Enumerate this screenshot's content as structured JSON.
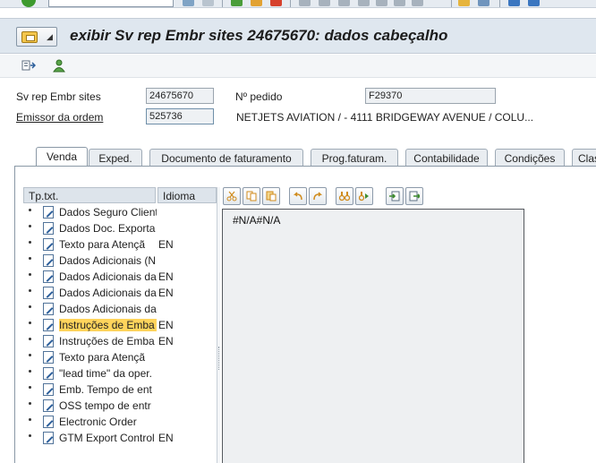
{
  "toolbar": {
    "icons": [
      "enter-icon",
      "command-field",
      "save-icon",
      "back-icon",
      "exit-icon",
      "cancel-icon",
      "print-icon",
      "find-icon",
      "find-next-icon",
      "first-page-icon",
      "prev-page-icon",
      "next-page-icon",
      "last-page-icon",
      "new-session-icon",
      "shortcut-icon",
      "help-icon",
      "settings-icon"
    ]
  },
  "title": {
    "text": "exibir Sv rep Embr sites 24675670: dados cabeçalho"
  },
  "header": {
    "doc_label": "Sv rep Embr sites",
    "doc_value": "24675670",
    "po_label": "Nº pedido",
    "po_value": "F29370",
    "issuer_label": "Emissor da ordem",
    "issuer_value": "525736",
    "issuer_name": "NETJETS AVIATION / - 4111 BRIDGEWAY AVENUE / COLU..."
  },
  "tabs": [
    {
      "label": "Venda",
      "active": true
    },
    {
      "label": "Exped.",
      "active": false
    },
    {
      "label": "Documento de faturamento",
      "active": false
    },
    {
      "label": "Prog.faturam.",
      "active": false
    },
    {
      "label": "Contabilidade",
      "active": false
    },
    {
      "label": "Condições",
      "active": false
    },
    {
      "label": "Clas",
      "active": false
    }
  ],
  "tree": {
    "col_type": "Tp.txt.",
    "col_lang": "Idioma",
    "rows": [
      {
        "text": "Dados Seguro Client",
        "lang": "",
        "selected": false
      },
      {
        "text": "Dados Doc. Exporta",
        "lang": "",
        "selected": false
      },
      {
        "text": "Texto para Atençã",
        "lang": "EN",
        "selected": false
      },
      {
        "text": "Dados Adicionais (N",
        "lang": "",
        "selected": false
      },
      {
        "text": "Dados Adicionais da",
        "lang": "EN",
        "selected": false
      },
      {
        "text": "Dados Adicionais da",
        "lang": "EN",
        "selected": false
      },
      {
        "text": "Dados Adicionais da",
        "lang": "",
        "selected": false
      },
      {
        "text": "Instruções de Emba",
        "lang": "EN",
        "selected": true
      },
      {
        "text": "Instruções de Emba",
        "lang": "EN",
        "selected": false
      },
      {
        "text": "Texto para Atençã",
        "lang": "",
        "selected": false
      },
      {
        "text": "\"lead time\" da oper.",
        "lang": "",
        "selected": false
      },
      {
        "text": "Emb. Tempo de ent",
        "lang": "",
        "selected": false
      },
      {
        "text": "OSS tempo de entr",
        "lang": "",
        "selected": false
      },
      {
        "text": "Electronic Order",
        "lang": "",
        "selected": false
      },
      {
        "text": "GTM Export Control",
        "lang": "EN",
        "selected": false
      }
    ]
  },
  "editor": {
    "content": "#N/A#N/A",
    "tools": [
      "cut-icon",
      "copy-icon",
      "paste-icon",
      "undo-icon",
      "redo-icon",
      "find-icon",
      "replace-icon",
      "import-icon",
      "export-icon"
    ]
  },
  "colors": {
    "titlebar": "#dfe7ef",
    "selection": "#ffd45c",
    "panel_border": "#8a98a6"
  }
}
